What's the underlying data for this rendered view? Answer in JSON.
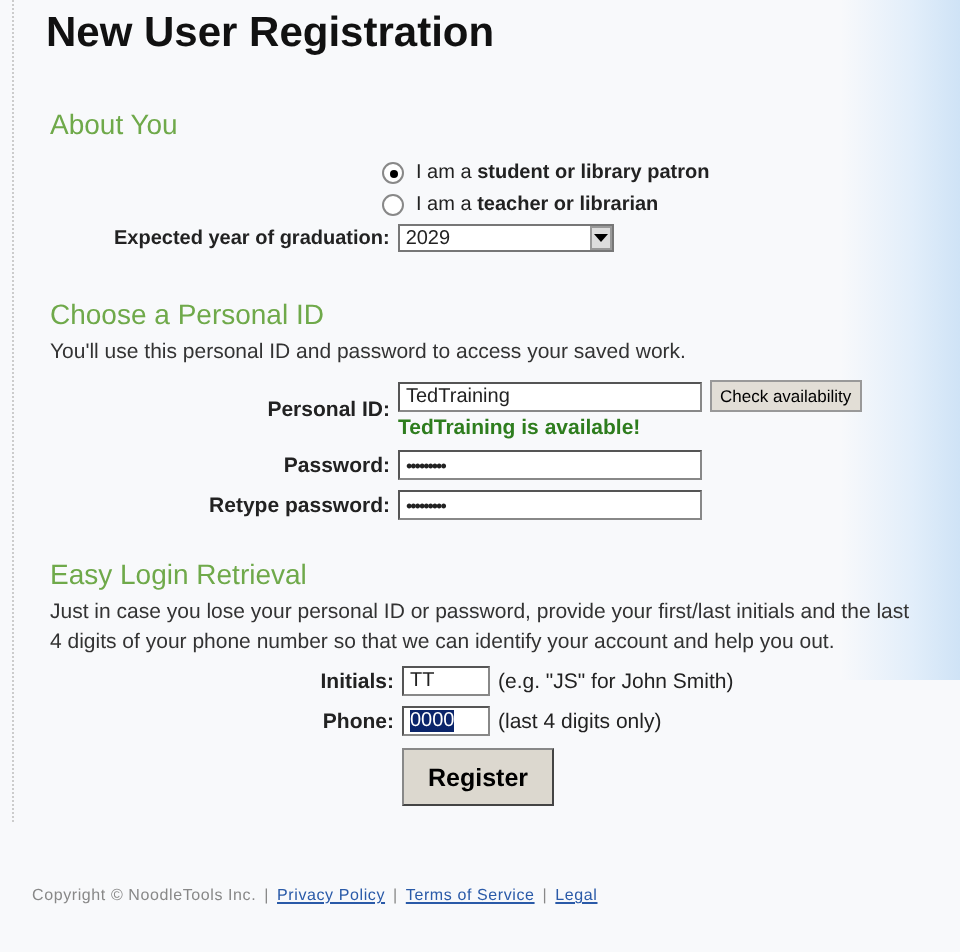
{
  "title": "New User Registration",
  "about": {
    "heading": "About You",
    "roles": [
      {
        "label": "I am a **student or library patron**",
        "selected": true
      },
      {
        "label": "I am a **teacher or librarian**",
        "selected": false
      }
    ],
    "year_label": "Expected year of graduation:",
    "year_value": "2029"
  },
  "personal": {
    "heading": "Choose a Personal ID",
    "intro": "You'll use this personal ID and password to access your saved work.",
    "id_label": "Personal ID:",
    "id_value": "TedTraining",
    "check_button": "Check availability",
    "availability": "TedTraining is available!",
    "password_label": "Password:",
    "password_value": "•••••••••",
    "retype_label": "Retype password:",
    "retype_value": "•••••••••"
  },
  "retrieval": {
    "heading": "Easy Login Retrieval",
    "intro": "Just in case you lose your personal ID or password, provide your first/last initials and the last 4 digits of your phone number so that we can identify your account and help you out.",
    "initials_label": "Initials:",
    "initials_value": "TT",
    "initials_hint": "(e.g. \"JS\" for John Smith)",
    "phone_label": "Phone:",
    "phone_value": "0000",
    "phone_value_selected": true,
    "phone_hint": "(last 4 digits only)"
  },
  "register_button": "Register",
  "footer": {
    "copyright": "Copyright © NoodleTools Inc.",
    "separators": [
      "|",
      "|",
      "|"
    ],
    "links": [
      "Privacy Policy",
      "Terms of Service",
      "Legal"
    ]
  }
}
